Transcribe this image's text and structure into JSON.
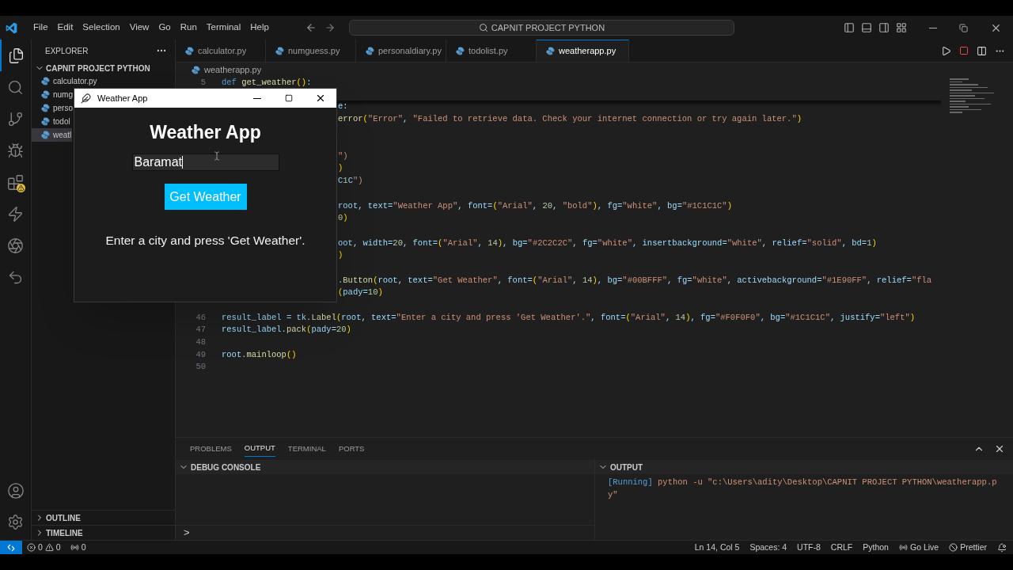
{
  "title_bar": {
    "menus": [
      "File",
      "Edit",
      "Selection",
      "View",
      "Go",
      "Run",
      "Terminal",
      "Help"
    ],
    "search": "CAPNIT PROJECT PYTHON"
  },
  "activity_bar": {
    "items": [
      {
        "kind": "files",
        "selected": true
      },
      {
        "kind": "search",
        "selected": false
      },
      {
        "kind": "source",
        "selected": false
      },
      {
        "kind": "debug",
        "selected": false
      },
      {
        "kind": "extensions",
        "selected": false
      },
      {
        "kind": "bolt",
        "selected": false
      },
      {
        "kind": "aperture",
        "selected": false
      },
      {
        "kind": "remote",
        "selected": false
      }
    ]
  },
  "sidebar": {
    "title": "EXPLORER",
    "project": "CAPNIT PROJECT PYTHON",
    "items": [
      {
        "label": "calculator.py",
        "selected": false
      },
      {
        "label": "numg",
        "selected": false
      },
      {
        "label": "perso",
        "selected": false
      },
      {
        "label": "todol",
        "selected": false
      },
      {
        "label": "weatl",
        "selected": true
      }
    ],
    "sections": [
      "OUTLINE",
      "TIMELINE"
    ]
  },
  "tabs": [
    {
      "label": "calculator.py",
      "selected": false
    },
    {
      "label": "numguess.py",
      "selected": false
    },
    {
      "label": "personaldiary.py",
      "selected": false
    },
    {
      "label": "todolist.py",
      "selected": false
    },
    {
      "label": "weatherapp.py",
      "selected": true
    }
  ],
  "breadcrumb": "weatherapp.py",
  "sticky_line": {
    "number": "5",
    "text": "def get_weather():"
  },
  "code_lines": [
    {
      "kind": "partial",
      "text": "e:"
    },
    {
      "kind": "partial",
      "text": "error(\"Error\", \"Failed to retrieve data. Check your internet connection or try again later.\")"
    },
    {
      "kind": "blank"
    },
    {
      "kind": "blank"
    },
    {
      "kind": "partial",
      "text": "\")"
    },
    {
      "kind": "partial",
      "text": ")"
    },
    {
      "kind": "partial",
      "text": "C1C\")"
    },
    {
      "kind": "blank"
    },
    {
      "kind": "partial",
      "text": "root, text=\"Weather App\", font=(\"Arial\", 20, \"bold\"), fg=\"white\", bg=\"#1C1C1C\")"
    },
    {
      "kind": "partial",
      "text": "0)"
    },
    {
      "kind": "blank"
    },
    {
      "kind": "partial",
      "text": "oot, width=20, font=(\"Arial\", 14), bg=\"#2C2C2C\", fg=\"white\", insertbackground=\"white\", relief=\"solid\", bd=1)"
    },
    {
      "kind": "partial",
      "text": ")"
    },
    {
      "kind": "blank"
    },
    {
      "kind": "partial",
      "text": ".Button(root, text=\"Get Weather\", font=(\"Arial\", 14), bg=\"#00BFFF\", fg=\"white\", activebackground=\"#1E90FF\", relief=\"fla"
    },
    {
      "kind": "partial",
      "text": "(pady=10)"
    },
    {
      "kind": "blank"
    },
    {
      "kind": "full",
      "number": "46",
      "text": "result_label = tk.Label(root, text=\"Enter a city and press 'Get Weather'.\", font=(\"Arial\", 14), fg=\"#F0F0F0\", bg=\"#1C1C1C\", justify=\"left\")"
    },
    {
      "kind": "full",
      "number": "47",
      "text": "result_label.pack(pady=20)"
    },
    {
      "kind": "full",
      "number": "48"
    },
    {
      "kind": "full",
      "number": "49",
      "text": "root.mainloop()"
    },
    {
      "kind": "full",
      "number": "50"
    }
  ],
  "panel": {
    "tabs": [
      {
        "label": "PROBLEMS",
        "selected": false
      },
      {
        "label": "OUTPUT",
        "selected": true
      },
      {
        "label": "TERMINAL",
        "selected": false
      },
      {
        "label": "PORTS",
        "selected": false
      }
    ],
    "debug_console": {
      "title": "DEBUG CONSOLE",
      "prompt": ">"
    },
    "output": {
      "title": "OUTPUT",
      "tag": "[Running]",
      "command": "python -u \"c:\\Users\\adity\\Desktop\\CAPNIT PROJECT PYTHON\\weatherapp.py\""
    }
  },
  "status_bar": {
    "errors": "0",
    "warnings": "0",
    "ports": "0",
    "right": [
      {
        "kind": "text",
        "label": "Ln 14, Col 5"
      },
      {
        "kind": "text",
        "label": "Spaces: 4"
      },
      {
        "kind": "text",
        "label": "UTF-8"
      },
      {
        "kind": "text",
        "label": "CRLF"
      },
      {
        "kind": "text",
        "label": "Python"
      },
      {
        "kind": "live",
        "label": "Go Live"
      },
      {
        "kind": "prettier",
        "label": "Prettier"
      },
      {
        "kind": "bell"
      }
    ]
  },
  "app_window": {
    "title": "Weather App",
    "heading": "Weather App",
    "input_value": "Baramat",
    "button": "Get Weather",
    "result": "Enter a city and press 'Get Weather'."
  }
}
